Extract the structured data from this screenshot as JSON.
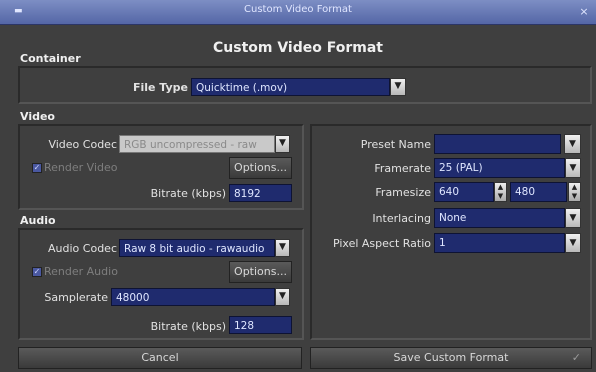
{
  "window": {
    "title": "Custom Video Format",
    "heading": "Custom Video Format"
  },
  "container": {
    "section_label": "Container",
    "file_type": {
      "label": "File Type",
      "value": "Quicktime (.mov)"
    }
  },
  "video": {
    "section_label": "Video",
    "codec": {
      "label": "Video Codec",
      "value": "RGB uncompressed - raw"
    },
    "render": {
      "label": "Render Video",
      "checked": true
    },
    "options_label": "Options...",
    "bitrate": {
      "label": "Bitrate (kbps)",
      "value": "8192"
    }
  },
  "audio": {
    "section_label": "Audio",
    "codec": {
      "label": "Audio Codec",
      "value": "Raw 8 bit audio - rawaudio"
    },
    "render": {
      "label": "Render Audio",
      "checked": true
    },
    "options_label": "Options...",
    "samplerate": {
      "label": "Samplerate",
      "value": "48000"
    },
    "bitrate": {
      "label": "Bitrate (kbps)",
      "value": "128"
    }
  },
  "preset": {
    "preset_name": {
      "label": "Preset Name",
      "value": ""
    },
    "framerate": {
      "label": "Framerate",
      "value": "25 (PAL)"
    },
    "framesize": {
      "label": "Framesize",
      "width": "640",
      "height": "480"
    },
    "interlacing": {
      "label": "Interlacing",
      "value": "None"
    },
    "pixel_aspect": {
      "label": "Pixel Aspect Ratio",
      "value": "1"
    }
  },
  "buttons": {
    "cancel": "Cancel",
    "save": "Save Custom Format"
  },
  "icons": {
    "dropdown": "▼",
    "spin_up": "▲",
    "spin_down": "▼",
    "check": "✓",
    "close": "×",
    "window": "▬",
    "save_check": "✓"
  },
  "colors": {
    "field_bg": "#1f2b6e",
    "titlebar": "#5466a6",
    "window_bg": "#3f3f3f"
  }
}
